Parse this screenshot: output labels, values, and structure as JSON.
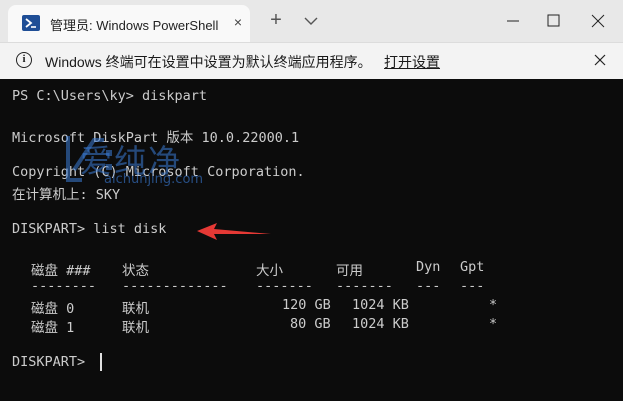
{
  "window": {
    "tab_title": "管理员: Windows PowerShell",
    "tab_close": "×",
    "new_tab": "+",
    "icon": "powershell-icon"
  },
  "notification": {
    "text": "Windows 终端可在设置中设置为默认终端应用程序。",
    "link": "打开设置"
  },
  "terminal": {
    "lines": [
      "PS C:\\Users\\ky> diskpart",
      "Microsoft DiskPart 版本 10.0.22000.1",
      "Copyright (C) Microsoft Corporation.",
      "在计算机上: SKY",
      "DISKPART> list disk",
      "DISKPART> "
    ],
    "table": {
      "headers": [
        "磁盘 ###",
        "状态",
        "大小",
        "可用",
        "Dyn",
        "Gpt"
      ],
      "separators": [
        "--------",
        "-------------",
        "-------",
        "-------",
        "---",
        "---"
      ],
      "rows": [
        [
          "磁盘 0",
          "联机",
          "120 GB",
          "1024 KB",
          "",
          "*"
        ],
        [
          "磁盘 1",
          "联机",
          "80 GB",
          "1024 KB",
          "",
          "*"
        ]
      ]
    }
  },
  "watermark": {
    "text": "爱纯净",
    "sub": "aichunjing.com"
  },
  "colors": {
    "terminal_bg": "#0c0c0c",
    "terminal_fg": "#cccccc",
    "arrow": "#e53935"
  }
}
